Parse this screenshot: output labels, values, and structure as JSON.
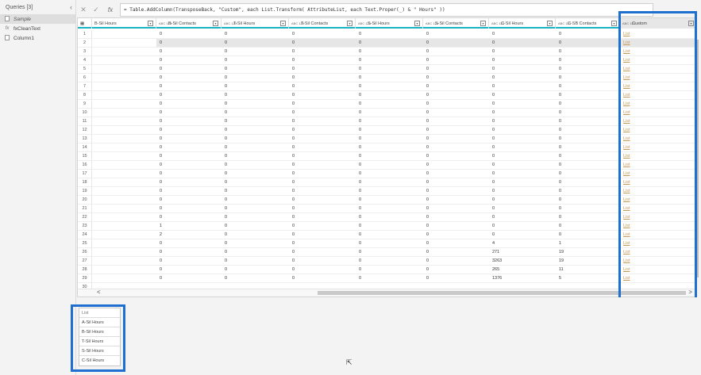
{
  "queries": {
    "title": "Queries [3]",
    "collapse": "‹",
    "items": [
      {
        "label": "Sample",
        "icon": "table-icon",
        "selected": true
      },
      {
        "label": "fxCleanText",
        "icon": "fx-icon",
        "selected": false
      },
      {
        "label": "Column1",
        "icon": "table-icon",
        "selected": false
      }
    ]
  },
  "formula_bar": {
    "cancel": "✕",
    "confirm": "✓",
    "fx": "fx",
    "text": "= Table.AddColumn(TransposeBack, \"Custom\", each List.Transform( AttributeList, each Text.Proper(_) & \" Hours\" ))"
  },
  "grid": {
    "columns": [
      {
        "name": "B-Sil Hours",
        "type": ""
      },
      {
        "name": "B-Sil Contacts",
        "type": "ABC 123"
      },
      {
        "name": "T-Sil Hours",
        "type": "ABC 123"
      },
      {
        "name": "T-Sil Contacts",
        "type": "ABC 123"
      },
      {
        "name": "S-Sil Hours",
        "type": "ABC 123"
      },
      {
        "name": "S-Sil Contacts",
        "type": "ABC 123"
      },
      {
        "name": "C-Sil Hours",
        "type": "ABC 123"
      },
      {
        "name": "C-SB Contacts",
        "type": "ABC 123"
      },
      {
        "name": "Custom",
        "type": "ABC 123"
      }
    ],
    "rows": [
      {
        "n": "1",
        "v": [
          "0",
          "0",
          "0",
          "0",
          "0",
          "0",
          "0"
        ],
        "c": "List"
      },
      {
        "n": "2",
        "v": [
          "0",
          "0",
          "0",
          "0",
          "0",
          "0",
          "0"
        ],
        "c": "List"
      },
      {
        "n": "3",
        "v": [
          "0",
          "0",
          "0",
          "0",
          "0",
          "0",
          "0"
        ],
        "c": "List"
      },
      {
        "n": "4",
        "v": [
          "0",
          "0",
          "0",
          "0",
          "0",
          "0",
          "0"
        ],
        "c": "List"
      },
      {
        "n": "5",
        "v": [
          "0",
          "0",
          "0",
          "0",
          "0",
          "0",
          "0"
        ],
        "c": "List"
      },
      {
        "n": "6",
        "v": [
          "0",
          "0",
          "0",
          "0",
          "0",
          "0",
          "0"
        ],
        "c": "List"
      },
      {
        "n": "7",
        "v": [
          "0",
          "0",
          "0",
          "0",
          "0",
          "0",
          "0"
        ],
        "c": "List"
      },
      {
        "n": "8",
        "v": [
          "0",
          "0",
          "0",
          "0",
          "0",
          "0",
          "0"
        ],
        "c": "List"
      },
      {
        "n": "9",
        "v": [
          "0",
          "0",
          "0",
          "0",
          "0",
          "0",
          "0"
        ],
        "c": "List"
      },
      {
        "n": "10",
        "v": [
          "0",
          "0",
          "0",
          "0",
          "0",
          "0",
          "0"
        ],
        "c": "List"
      },
      {
        "n": "11",
        "v": [
          "0",
          "0",
          "0",
          "0",
          "0",
          "0",
          "0"
        ],
        "c": "List"
      },
      {
        "n": "12",
        "v": [
          "0",
          "0",
          "0",
          "0",
          "0",
          "0",
          "0"
        ],
        "c": "List"
      },
      {
        "n": "13",
        "v": [
          "0",
          "0",
          "0",
          "0",
          "0",
          "0",
          "0"
        ],
        "c": "List"
      },
      {
        "n": "14",
        "v": [
          "0",
          "0",
          "0",
          "0",
          "0",
          "0",
          "0"
        ],
        "c": "List"
      },
      {
        "n": "15",
        "v": [
          "0",
          "0",
          "0",
          "0",
          "0",
          "0",
          "0"
        ],
        "c": "List"
      },
      {
        "n": "16",
        "v": [
          "0",
          "0",
          "0",
          "0",
          "0",
          "0",
          "0"
        ],
        "c": "List"
      },
      {
        "n": "17",
        "v": [
          "0",
          "0",
          "0",
          "0",
          "0",
          "0",
          "0"
        ],
        "c": "List"
      },
      {
        "n": "18",
        "v": [
          "0",
          "0",
          "0",
          "0",
          "0",
          "0",
          "0"
        ],
        "c": "List"
      },
      {
        "n": "19",
        "v": [
          "0",
          "0",
          "0",
          "0",
          "0",
          "0",
          "0"
        ],
        "c": "List"
      },
      {
        "n": "20",
        "v": [
          "0",
          "0",
          "0",
          "0",
          "0",
          "0",
          "0"
        ],
        "c": "List"
      },
      {
        "n": "21",
        "v": [
          "0",
          "0",
          "0",
          "0",
          "0",
          "0",
          "0"
        ],
        "c": "List"
      },
      {
        "n": "22",
        "v": [
          "0",
          "0",
          "0",
          "0",
          "0",
          "0",
          "0"
        ],
        "c": "List"
      },
      {
        "n": "23",
        "v": [
          "1",
          "0",
          "0",
          "0",
          "0",
          "0",
          "0"
        ],
        "c": "List"
      },
      {
        "n": "24",
        "v": [
          "2",
          "0",
          "0",
          "0",
          "0",
          "0",
          "0"
        ],
        "c": "List"
      },
      {
        "n": "25",
        "v": [
          "0",
          "0",
          "0",
          "0",
          "0",
          "4",
          "1"
        ],
        "c": "List"
      },
      {
        "n": "26",
        "v": [
          "0",
          "0",
          "0",
          "0",
          "0",
          "271",
          "19"
        ],
        "c": "List"
      },
      {
        "n": "27",
        "v": [
          "0",
          "0",
          "0",
          "0",
          "0",
          "3263",
          "19"
        ],
        "c": "List"
      },
      {
        "n": "28",
        "v": [
          "0",
          "0",
          "0",
          "0",
          "0",
          "265",
          "11"
        ],
        "c": "List"
      },
      {
        "n": "29",
        "v": [
          "0",
          "0",
          "0",
          "0",
          "0",
          "1376",
          "5"
        ],
        "c": "List"
      },
      {
        "n": "30",
        "v": [
          "",
          "",
          "",
          "",
          "",
          "",
          ""
        ],
        "c": ""
      }
    ],
    "selected_row": "2",
    "hscroll_left": "<",
    "hscroll_right": ">"
  },
  "preview": {
    "header": "List",
    "items": [
      "A-Sil Hours",
      "B-Sil Hours",
      "T-Sil Hours",
      "S-Sil Hours",
      "C-Sil Hours"
    ]
  },
  "colors": {
    "accent": "#16b4c4",
    "highlight": "#1f6fd0",
    "list_link": "#c59a5a"
  }
}
